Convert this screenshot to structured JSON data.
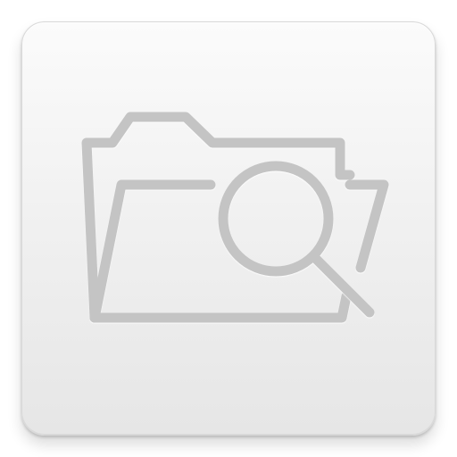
{
  "app_icon": {
    "icon_name": "folder-search-icon",
    "colors": {
      "tile_top": "#fbfbfb",
      "tile_bottom": "#e6e6e6",
      "glyph_stroke": "#c4c4c4",
      "glyph_highlight": "#ffffff"
    },
    "parts": {
      "folder": "folder-icon",
      "magnifier": "magnifier-icon"
    }
  }
}
